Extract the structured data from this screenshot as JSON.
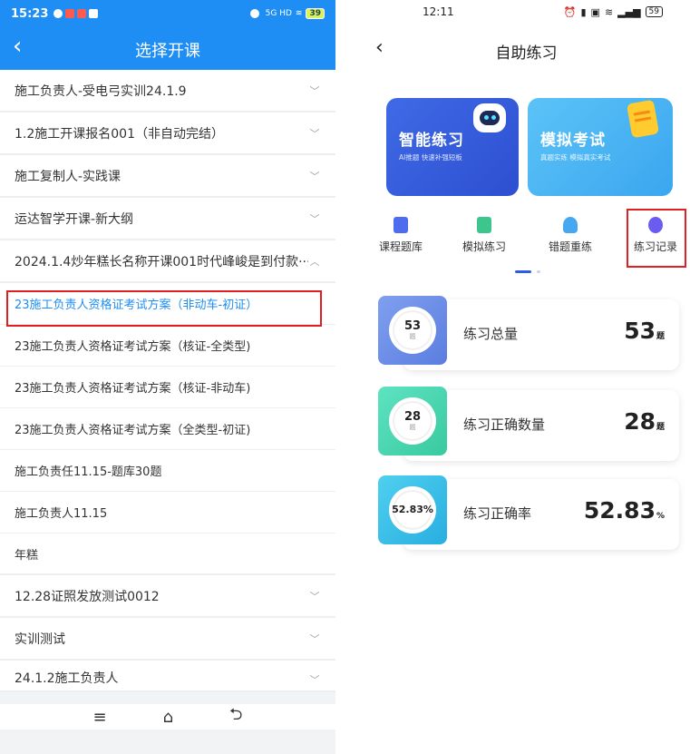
{
  "left": {
    "status": {
      "time": "15:23",
      "signal": "5G HD",
      "battery": "39"
    },
    "title": "选择开课",
    "courses": [
      {
        "label": "施工负责人-受电弓实训24.1.9",
        "expanded": false
      },
      {
        "label": "1.2施工开课报名001（非自动完结）",
        "expanded": false
      },
      {
        "label": "施工复制人-实践课",
        "expanded": false
      },
      {
        "label": "运达智学开课-新大纲",
        "expanded": false
      },
      {
        "label": "2024.1.4炒年糕长名称开课001时代峰峻是到付款···",
        "expanded": true
      }
    ],
    "subitems": [
      {
        "label": "23施工负责人资格证考试方案（非动车-初证）",
        "selected": true
      },
      {
        "label": "23施工负责人资格证考试方案（核证-全类型)",
        "selected": false
      },
      {
        "label": "23施工负责人资格证考试方案（核证-非动车)",
        "selected": false
      },
      {
        "label": "23施工负责人资格证考试方案（全类型-初证)",
        "selected": false
      },
      {
        "label": "施工负责任11.15-题库30题",
        "selected": false
      },
      {
        "label": "施工负责人11.15",
        "selected": false
      },
      {
        "label": "年糕",
        "selected": false
      }
    ],
    "more_courses": [
      {
        "label": "12.28证照发放测试0012"
      },
      {
        "label": "实训测试"
      },
      {
        "label": "24.1.2施工负责人"
      }
    ],
    "nav": {
      "menu_icon": "menu-icon",
      "home_icon": "home-icon",
      "back_icon": "back-icon"
    }
  },
  "right": {
    "status": {
      "time": "12:11",
      "battery": "59"
    },
    "title": "自助练习",
    "banners": [
      {
        "title": "智能练习",
        "subtitle": "AI推题 快速补强短板",
        "color": "#3f6ae6"
      },
      {
        "title": "模拟考试",
        "subtitle": "真题实练 模拟真实考试",
        "color": "#4db7f3"
      }
    ],
    "tabs": [
      {
        "label": "课程题库",
        "icon": "book-icon",
        "color": "#4e6cf0"
      },
      {
        "label": "模拟练习",
        "icon": "list-icon",
        "color": "#3cc58c"
      },
      {
        "label": "错题重练",
        "icon": "drop-icon",
        "color": "#47a8f2"
      },
      {
        "label": "练习记录",
        "icon": "clock-icon",
        "color": "#6a5cf0"
      }
    ],
    "stats": [
      {
        "ring_value": "53",
        "ring_unit": "题",
        "label": "练习总量",
        "value": "53",
        "unit": "题"
      },
      {
        "ring_value": "28",
        "ring_unit": "题",
        "label": "练习正确数量",
        "value": "28",
        "unit": "题"
      },
      {
        "ring_value": "52.83%",
        "ring_unit": "",
        "label": "练习正确率",
        "value": "52.83",
        "unit": "%"
      }
    ]
  }
}
